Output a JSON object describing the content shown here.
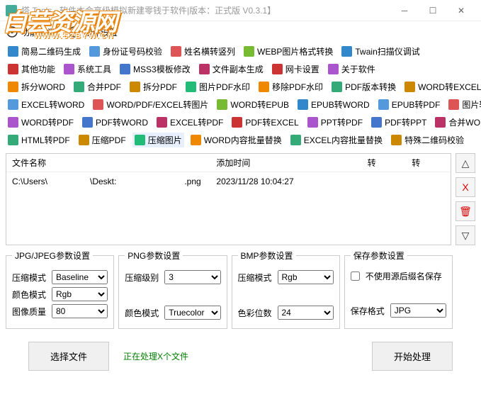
{
  "window": {
    "title": "塔 Tools - 软件本会高级模拟新建零钱于软件|版本：正式版 V0.3.1】"
  },
  "overlay": {
    "logo": "白芸资源网",
    "url": "WWW.52BYW.CN"
  },
  "menu": {
    "category": "功能分类",
    "settings": "软件设置"
  },
  "tabs": {
    "r1": [
      "简易二维码生成",
      "身份证号码校验",
      "姓名横转竖列",
      "WEBP图片格式转换",
      "Twain扫描仪调试"
    ],
    "r2": [
      "其他功能",
      "系统工具",
      "MSS3模板修改",
      "文件副本生成",
      "网卡设置",
      "关于软件"
    ],
    "r3": [
      "拆分WORD",
      "合并PDF",
      "拆分PDF",
      "图片PDF水印",
      "移除PDF水印",
      "PDF版本转换",
      "WORD转EXCEL"
    ],
    "r4": [
      "EXCEL转WORD",
      "WORD/PDF/EXCEL转图片",
      "WORD转EPUB",
      "EPUB转WORD",
      "EPUB转PDF",
      "图片转PDF"
    ],
    "r5": [
      "WORD转PDF",
      "PDF转WORD",
      "EXCEL转PDF",
      "PDF转EXCEL",
      "PPT转PDF",
      "PDF转PPT",
      "合并WORD"
    ],
    "r6": [
      "HTML转PDF",
      "压缩PDF",
      "压缩图片",
      "WORD内容批量替换",
      "EXCEL内容批量替换",
      "特殊二维码校验"
    ]
  },
  "fileTable": {
    "headers": [
      "文件名称",
      "添加时间",
      "转",
      "转"
    ],
    "rows": [
      {
        "name": "C:\\Users\\　　　　　\\Deskt:　　　　　　　　.png",
        "time": "2023/11/28 10:04:27"
      }
    ]
  },
  "sideButtons": {
    "up": "△",
    "del": "X",
    "clear": "🗑",
    "down": "▽"
  },
  "params": {
    "jpg": {
      "legend": "JPG/JPEG参数设置",
      "mode_l": "压缩模式",
      "mode_v": "Baseline",
      "color_l": "颜色模式",
      "color_v": "Rgb",
      "quality_l": "图像质量",
      "quality_v": "80"
    },
    "png": {
      "legend": "PNG参数设置",
      "level_l": "压缩级别",
      "level_v": "3",
      "color_l": "颜色模式",
      "color_v": "Truecolor"
    },
    "bmp": {
      "legend": "BMP参数设置",
      "mode_l": "压缩模式",
      "mode_v": "Rgb",
      "bits_l": "色彩位数",
      "bits_v": "24"
    },
    "save": {
      "legend": "保存参数设置",
      "chk_l": "不使用源后缀名保存",
      "fmt_l": "保存格式",
      "fmt_v": "JPG"
    }
  },
  "bottom": {
    "select": "选择文件",
    "status": "正在处理X个文件",
    "start": "开始处理"
  }
}
